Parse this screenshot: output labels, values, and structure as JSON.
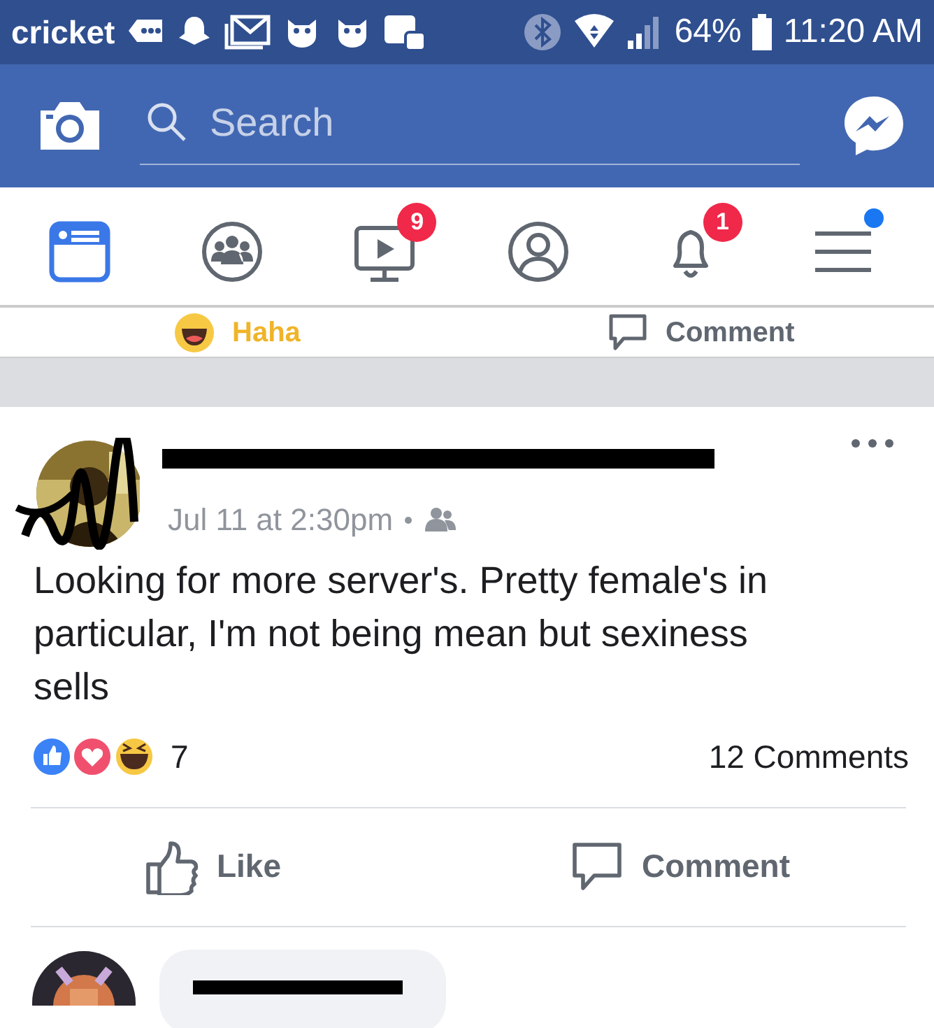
{
  "status_bar": {
    "carrier": "cricket",
    "battery": "64%",
    "time": "11:20 AM"
  },
  "header": {
    "search": {
      "placeholder": "Search"
    }
  },
  "nav_tabs": [
    {
      "kind": "news",
      "selected": true
    },
    {
      "kind": "groups",
      "selected": false
    },
    {
      "kind": "watch",
      "selected": false,
      "badge": "9"
    },
    {
      "kind": "profile",
      "selected": false
    },
    {
      "kind": "notifications",
      "selected": false,
      "badge": "1"
    },
    {
      "kind": "menu",
      "selected": false,
      "dot": true
    }
  ],
  "previous_post": {
    "actions": [
      {
        "kind": "haha",
        "label": "Haha"
      },
      {
        "kind": "comment",
        "label": "Comment"
      }
    ]
  },
  "post": {
    "author": {
      "redacted": true
    },
    "time": "Jul 11 at 2:30pm",
    "shared_with_friends": true,
    "text": "Looking for more server's. Pretty female's in particular, I'm not being mean but sexiness sells",
    "reaction_count": "7",
    "comments": "12 Comments",
    "actions": [
      {
        "kind": "like",
        "label": "Like"
      },
      {
        "kind": "comment",
        "label": "Comment"
      }
    ]
  },
  "comment": {
    "author": {
      "redacted": true
    }
  }
}
